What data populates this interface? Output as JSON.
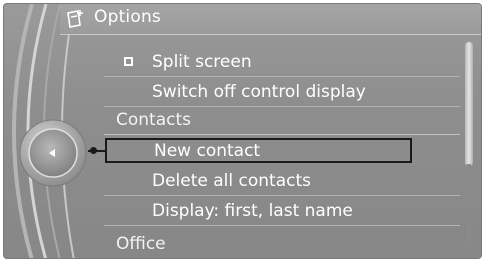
{
  "header": {
    "title": "Options",
    "icon": "settings-document-icon"
  },
  "menu": {
    "items": [
      {
        "label": "Split screen",
        "type": "checkbox",
        "checked": false
      },
      {
        "label": "Switch off control display",
        "type": "item"
      },
      {
        "label": "Contacts",
        "type": "section"
      },
      {
        "label": "New contact",
        "type": "item",
        "selected": true
      },
      {
        "label": "Delete all contacts",
        "type": "item"
      },
      {
        "label": "Display: first, last name",
        "type": "item"
      },
      {
        "label": "Office",
        "type": "section"
      }
    ]
  },
  "controller": {
    "icon": "left-arrow-icon"
  },
  "colors": {
    "background": "#919191",
    "text": "#ffffff",
    "selection_border": "#1a1a1a"
  }
}
